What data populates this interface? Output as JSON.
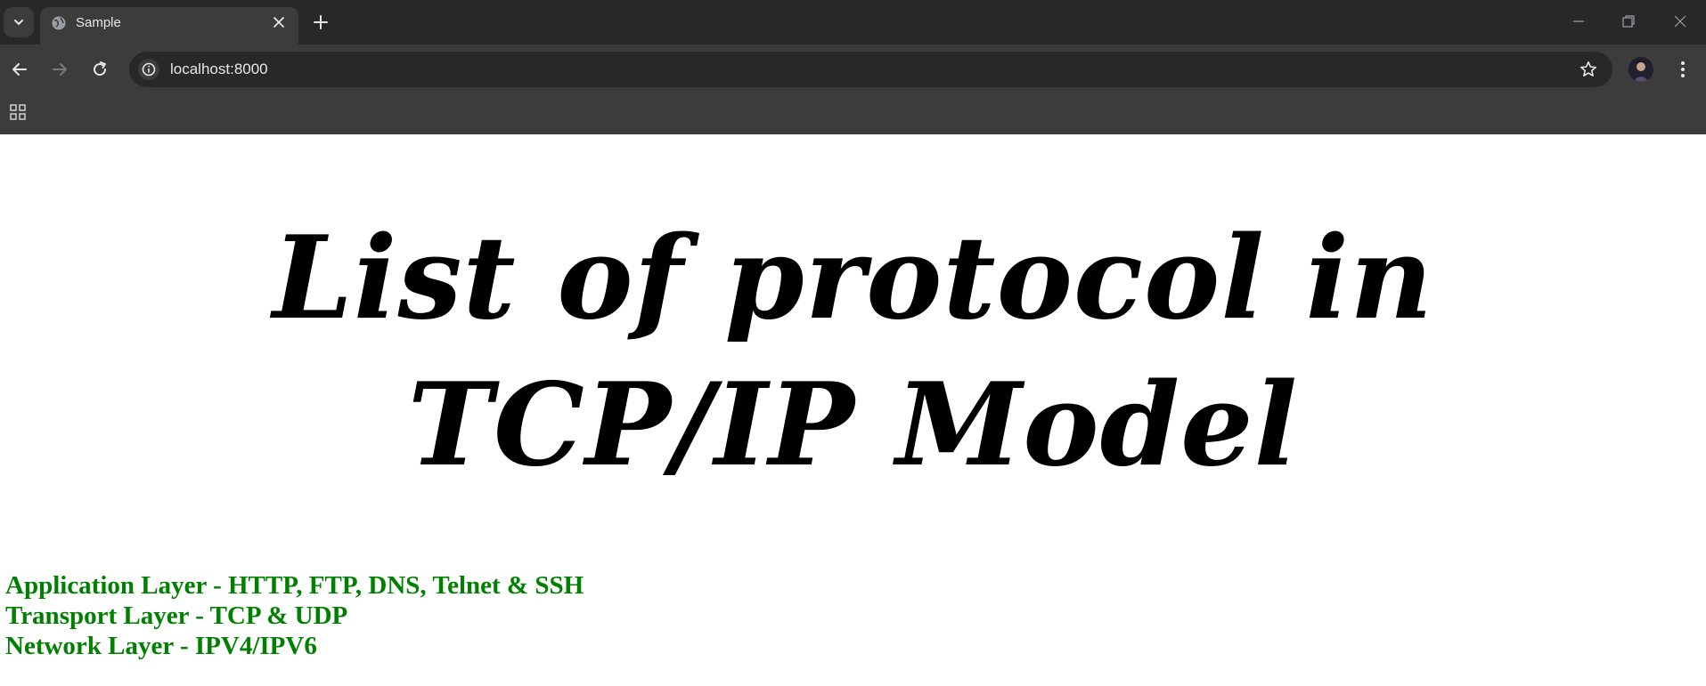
{
  "browser": {
    "tab": {
      "title": "Sample"
    },
    "address_bar": {
      "url": "localhost:8000"
    }
  },
  "icons": {
    "tab_search": "chevron-down-icon",
    "favicon": "globe-icon",
    "close_tab": "close-icon",
    "new_tab": "plus-icon",
    "minimize": "minimize-icon",
    "restore": "restore-icon",
    "close_window": "close-icon",
    "back": "arrow-left-icon",
    "forward": "arrow-right-icon",
    "reload": "reload-icon",
    "site_info": "info-icon",
    "bookmark": "star-icon",
    "profile": "avatar",
    "menu": "more-vertical-icon",
    "apps": "apps-grid-icon"
  },
  "page": {
    "heading": "List of protocol in TCP/IP Model",
    "layers": [
      "Application Layer - HTTP, FTP, DNS, Telnet & SSH",
      "Transport Layer - TCP & UDP",
      "Network Layer - IPV4/IPV6"
    ]
  },
  "colors": {
    "tabstrip_bg": "#282828",
    "toolbar_bg": "#3c3c3c",
    "page_bg": "#ffffff",
    "heading_color": "#000000",
    "layer_text_color": "#008000"
  }
}
